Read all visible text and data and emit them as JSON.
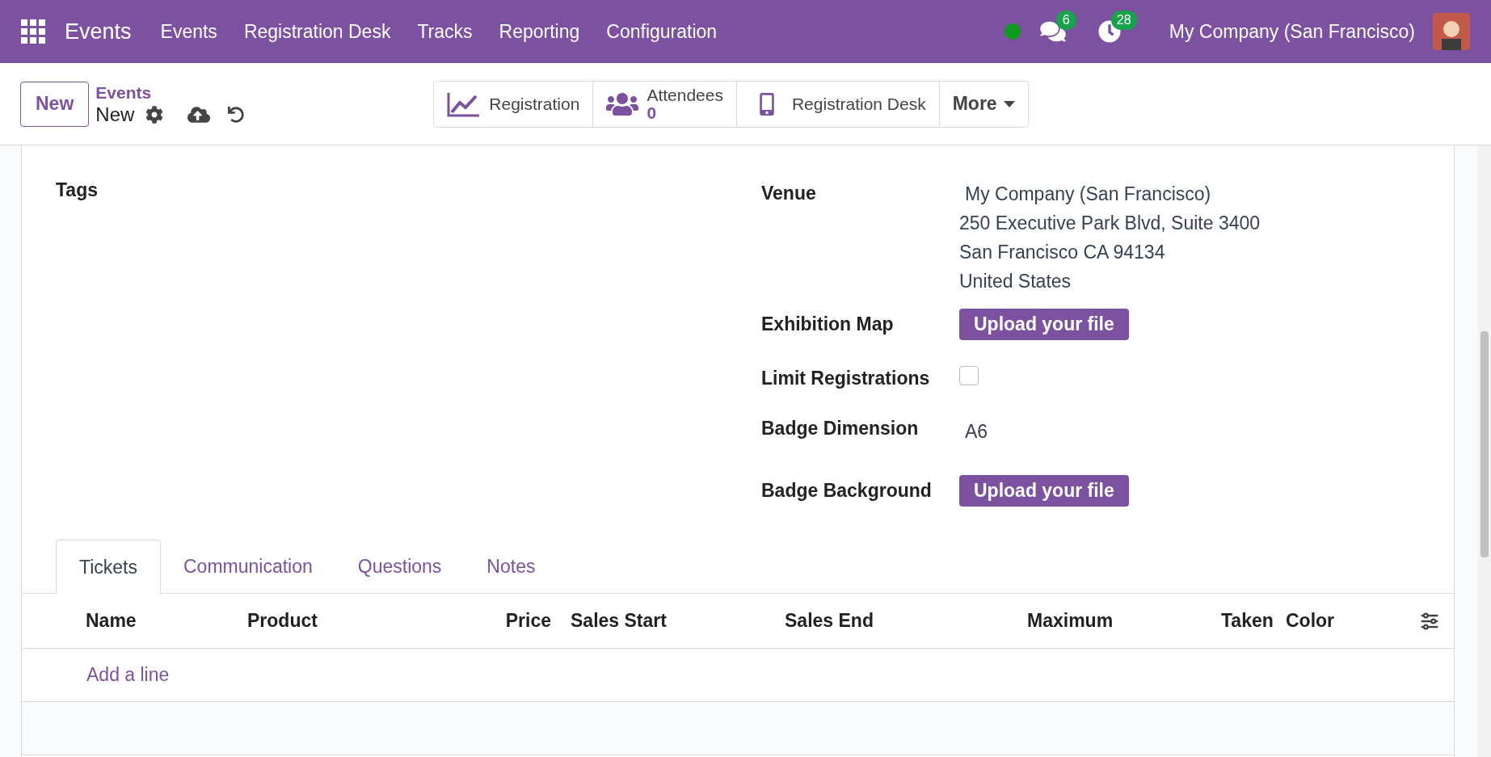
{
  "navbar": {
    "app": "Events",
    "menus": [
      "Events",
      "Registration Desk",
      "Tracks",
      "Reporting",
      "Configuration"
    ],
    "messages_count": "6",
    "activities_count": "28",
    "company": "My Company (San Francisco)"
  },
  "control_panel": {
    "new_button": "New",
    "breadcrumb": "Events",
    "record": "New",
    "smart_buttons": [
      {
        "kind": "simple",
        "label": "Registration"
      },
      {
        "kind": "stat",
        "label": "Attendees",
        "value": "0"
      },
      {
        "kind": "simple",
        "label": "Registration Desk"
      }
    ],
    "more": "More"
  },
  "form": {
    "tags_label": "Tags",
    "fields": [
      {
        "kind": "address",
        "label": "Venue",
        "lines": [
          "My Company (San Francisco)",
          "250 Executive Park Blvd, Suite 3400",
          "San Francisco CA 94134",
          "United States"
        ]
      },
      {
        "kind": "upload",
        "label": "Exhibition Map",
        "button": "Upload your file"
      },
      {
        "kind": "checkbox",
        "label": "Limit Registrations",
        "checked": false
      },
      {
        "kind": "text",
        "label": "Badge Dimension",
        "value": "A6"
      },
      {
        "kind": "upload",
        "label": "Badge Background",
        "button": "Upload your file"
      }
    ]
  },
  "tabs": [
    {
      "label": "Tickets",
      "selected": true
    },
    {
      "label": "Communication",
      "selected": false
    },
    {
      "label": "Questions",
      "selected": false
    },
    {
      "label": "Notes",
      "selected": false
    }
  ],
  "table": {
    "columns": [
      "Name",
      "Product",
      "Price",
      "Sales Start",
      "Sales End",
      "Maximum",
      "Taken",
      "Color"
    ],
    "add_line": "Add a line"
  }
}
